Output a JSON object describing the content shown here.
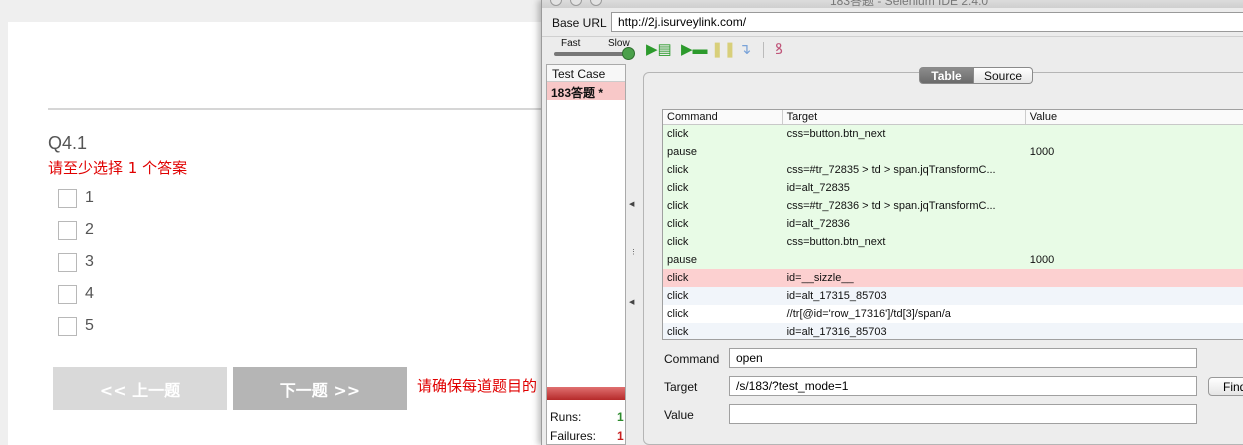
{
  "survey": {
    "question_title": "Q4.1",
    "error_message": "请至少选择 1 个答案",
    "options": [
      "1",
      "2",
      "3",
      "4",
      "5"
    ],
    "prev_label": "<< 上一题",
    "next_label": "下一题 >>",
    "hint": "请确保每道题目的"
  },
  "ide": {
    "window_title": "183答题 - Selenium IDE 2.4.0",
    "base_url_label": "Base URL",
    "base_url": "http://2j.isurveylink.com/",
    "speed_fast": "Fast",
    "speed_slow": "Slow",
    "test_case_header": "Test Case",
    "test_case_name": "183答题 *",
    "runs_label": "Runs:",
    "runs_value": "1",
    "failures_label": "Failures:",
    "failures_value": "1",
    "tab_table": "Table",
    "tab_source": "Source",
    "columns": [
      "Command",
      "Target",
      "Value"
    ],
    "rows": [
      {
        "command": "click",
        "target": "css=button.btn_next",
        "value": "",
        "status": "pass"
      },
      {
        "command": "pause",
        "target": "",
        "value": "1000",
        "status": "pass"
      },
      {
        "command": "click",
        "target": "css=#tr_72835 > td > span.jqTransformC...",
        "value": "",
        "status": "pass"
      },
      {
        "command": "click",
        "target": "id=alt_72835",
        "value": "",
        "status": "pass"
      },
      {
        "command": "click",
        "target": "css=#tr_72836 > td > span.jqTransformC...",
        "value": "",
        "status": "pass"
      },
      {
        "command": "click",
        "target": "id=alt_72836",
        "value": "",
        "status": "pass"
      },
      {
        "command": "click",
        "target": "css=button.btn_next",
        "value": "",
        "status": "pass"
      },
      {
        "command": "pause",
        "target": "",
        "value": "1000",
        "status": "pass"
      },
      {
        "command": "click",
        "target": "id=__sizzle__",
        "value": "",
        "status": "fail"
      },
      {
        "command": "click",
        "target": "id=alt_17315_85703",
        "value": "",
        "status": "none"
      },
      {
        "command": "click",
        "target": "//tr[@id='row_17316']/td[3]/span/a",
        "value": "",
        "status": "plain"
      },
      {
        "command": "click",
        "target": "id=alt_17316_85703",
        "value": "",
        "status": "none"
      }
    ],
    "command_label": "Command",
    "command_value": "open",
    "target_label": "Target",
    "target_value": "/s/183/?test_mode=1",
    "find_label": "Find",
    "value_label": "Value",
    "value_value": ""
  }
}
